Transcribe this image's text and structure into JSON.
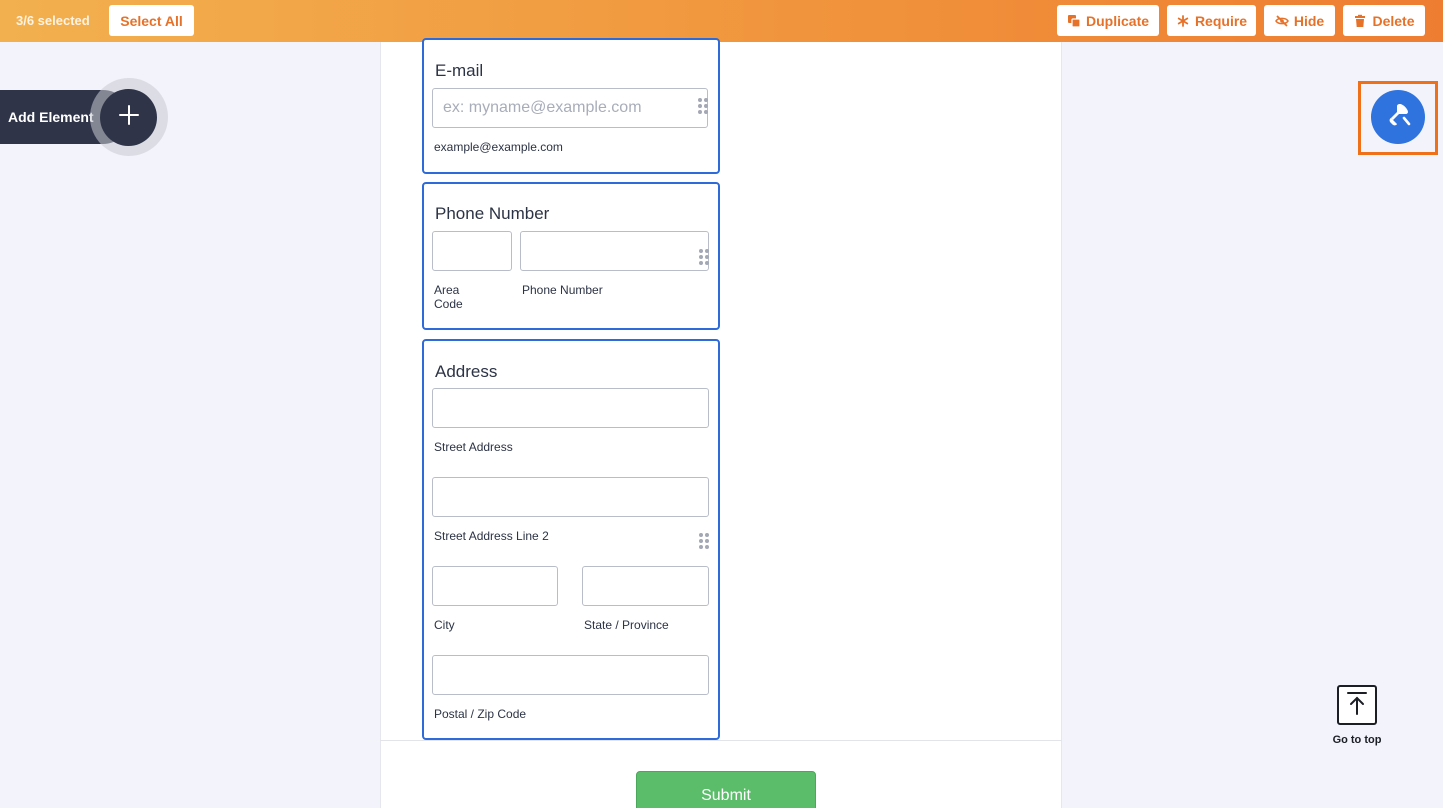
{
  "toolbar": {
    "selection_count": "3/6 selected",
    "select_all_label": "Select All",
    "duplicate_label": "Duplicate",
    "require_label": "Require",
    "hide_label": "Hide",
    "delete_label": "Delete"
  },
  "sidebar": {
    "add_element_label": "Add Element"
  },
  "form": {
    "email": {
      "title": "E-mail",
      "placeholder": "ex: myname@example.com",
      "sublabel": "example@example.com"
    },
    "phone": {
      "title": "Phone Number",
      "area_code_label": "Area Code",
      "number_label": "Phone Number"
    },
    "address": {
      "title": "Address",
      "street_label": "Street Address",
      "street2_label": "Street Address Line 2",
      "city_label": "City",
      "state_label": "State / Province",
      "postal_label": "Postal / Zip Code"
    },
    "submit_label": "Submit"
  },
  "right_panel": {
    "go_to_top_label": "Go to top"
  },
  "colors": {
    "accent_orange": "#ee7d31",
    "selected_border": "#2e6bd8",
    "paint_button": "#2e73de",
    "submit_green": "#5bbc6a"
  },
  "icons": {
    "duplicate": "duplicate-icon",
    "require": "asterisk-icon",
    "hide": "eye-off-icon",
    "delete": "trash-icon",
    "add": "plus-icon",
    "paint": "paint-roller-icon",
    "go_top": "arrow-up-to-line-icon"
  }
}
